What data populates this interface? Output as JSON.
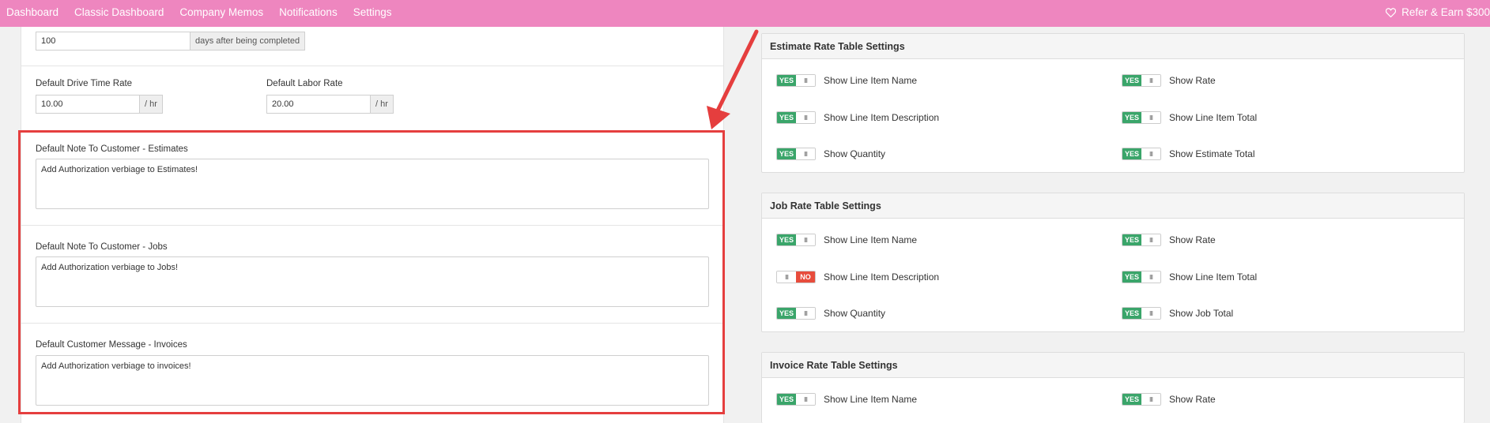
{
  "topbar": {
    "nav": [
      "Dashboard",
      "Classic Dashboard",
      "Company Memos",
      "Notifications",
      "Settings"
    ],
    "refer_label": "Refer & Earn $300"
  },
  "left": {
    "days_value": "100",
    "days_addon": "days after being completed",
    "drive_label": "Default Drive Time Rate",
    "drive_value": "10.00",
    "drive_addon": "/ hr",
    "labor_label": "Default Labor Rate",
    "labor_value": "20.00",
    "labor_addon": "/ hr",
    "est_label": "Default Note To Customer - Estimates",
    "est_value": "Add Authorization verbiage to Estimates!",
    "jobs_label": "Default Note To Customer - Jobs",
    "jobs_value": "Add Authorization verbiage to Jobs!",
    "inv_label": "Default Customer Message - Invoices",
    "inv_value": "Add Authorization verbiage to invoices!"
  },
  "toggle": {
    "yes": "YES",
    "no": "NO",
    "grip": "III"
  },
  "estimate_panel": {
    "title": "Estimate Rate Table Settings",
    "opts": [
      {
        "label": "Show Line Item Name",
        "on": true
      },
      {
        "label": "Show Rate",
        "on": true
      },
      {
        "label": "Show Line Item Description",
        "on": true
      },
      {
        "label": "Show Line Item Total",
        "on": true
      },
      {
        "label": "Show Quantity",
        "on": true
      },
      {
        "label": "Show Estimate Total",
        "on": true
      }
    ]
  },
  "job_panel": {
    "title": "Job Rate Table Settings",
    "opts": [
      {
        "label": "Show Line Item Name",
        "on": true
      },
      {
        "label": "Show Rate",
        "on": true
      },
      {
        "label": "Show Line Item Description",
        "on": false
      },
      {
        "label": "Show Line Item Total",
        "on": true
      },
      {
        "label": "Show Quantity",
        "on": true
      },
      {
        "label": "Show Job Total",
        "on": true
      }
    ]
  },
  "invoice_panel": {
    "title": "Invoice Rate Table Settings",
    "opts": [
      {
        "label": "Show Line Item Name",
        "on": true
      },
      {
        "label": "Show Rate",
        "on": true
      }
    ]
  },
  "colors": {
    "topbar": "#ee86bf",
    "yes": "#3aa56a",
    "no": "#e74c3c",
    "highlight": "#e53e3e"
  }
}
